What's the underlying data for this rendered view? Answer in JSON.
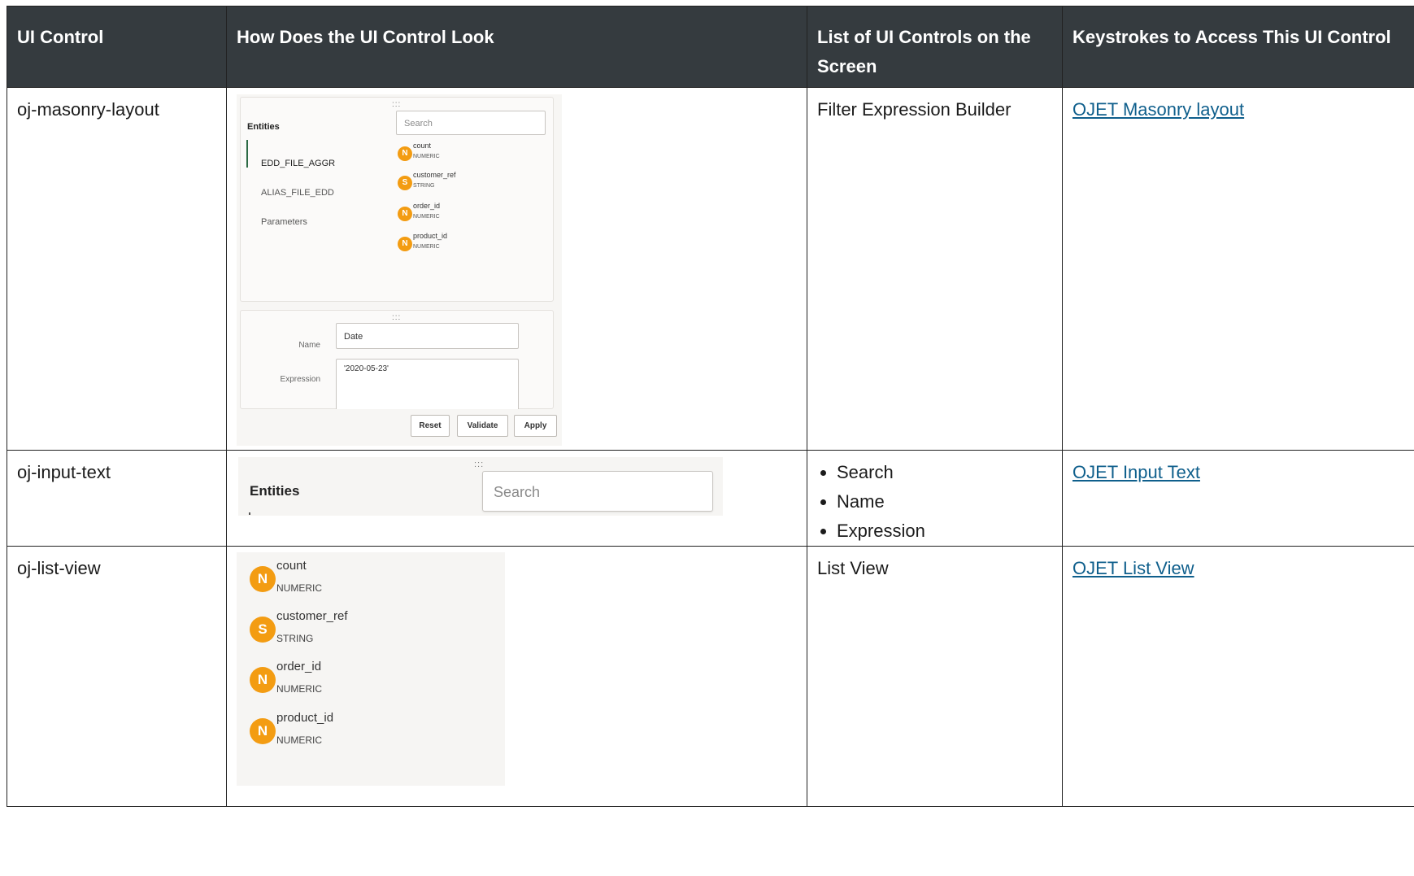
{
  "table": {
    "headers": [
      "UI Control",
      "How Does the UI Control Look",
      "List of UI Controls on the Screen",
      "Keystrokes to Access This UI Control"
    ],
    "rows": [
      {
        "control": "oj-masonry-layout",
        "list_text": "Filter Expression Builder",
        "link": "OJET Masonry layout"
      },
      {
        "control": "oj-input-text",
        "list_items": [
          "Search",
          "Name",
          "Expression"
        ],
        "link": "OJET Input Text"
      },
      {
        "control": "oj-list-view",
        "list_text": "List View",
        "link": "OJET List View"
      }
    ]
  },
  "masonry_shot": {
    "grip": ":::",
    "entities_title": "Entities",
    "search_placeholder": "Search",
    "entities": [
      "EDD_FILE_AGGR",
      "ALIAS_FILE_EDD",
      "Parameters"
    ],
    "attributes": [
      {
        "badge": "N",
        "name": "count",
        "type": "NUMERIC"
      },
      {
        "badge": "S",
        "name": "customer_ref",
        "type": "STRING"
      },
      {
        "badge": "N",
        "name": "order_id",
        "type": "NUMERIC"
      },
      {
        "badge": "N",
        "name": "product_id",
        "type": "NUMERIC"
      }
    ],
    "name_label": "Name",
    "name_value": "Date",
    "expression_label": "Expression",
    "expression_value": "'2020-05-23'",
    "buttons": [
      "Reset",
      "Validate",
      "Apply"
    ]
  },
  "input_shot": {
    "grip": ":::",
    "title": "Entities",
    "search_placeholder": "Search"
  },
  "list_shot": {
    "items": [
      {
        "badge": "N",
        "name": "count",
        "type": "NUMERIC"
      },
      {
        "badge": "S",
        "name": "customer_ref",
        "type": "STRING"
      },
      {
        "badge": "N",
        "name": "order_id",
        "type": "NUMERIC"
      },
      {
        "badge": "N",
        "name": "product_id",
        "type": "NUMERIC"
      }
    ]
  },
  "colors": {
    "header_bg": "#353b3f",
    "link": "#0f5f8c",
    "badge": "#f39c12"
  }
}
